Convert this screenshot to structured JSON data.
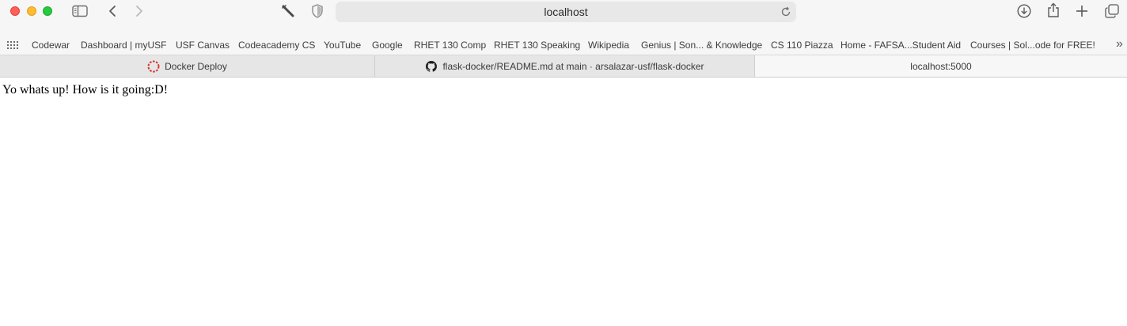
{
  "window": {
    "traffic_lights": [
      "close",
      "minimize",
      "zoom"
    ]
  },
  "toolbar": {
    "icons": [
      "sidebar-icon",
      "back-icon",
      "forward-icon",
      "extension-icon",
      "privacy-shield-icon",
      "download-icon",
      "share-icon",
      "new-tab-icon",
      "tab-overview-icon"
    ],
    "address": "localhost"
  },
  "bookmarks": {
    "items": [
      {
        "label": "Codewar"
      },
      {
        "label": "Dashboard | myUSF"
      },
      {
        "label": "USF Canvas"
      },
      {
        "label": "Codeacademy CS"
      },
      {
        "label": "YouTube"
      },
      {
        "label": "Google"
      },
      {
        "label": "RHET 130 Comp"
      },
      {
        "label": "RHET 130 Speaking"
      },
      {
        "label": "Wikipedia"
      },
      {
        "label": "Genius | Son... & Knowledge"
      },
      {
        "label": "CS 110 Piazza"
      },
      {
        "label": "Home - FAFSA...Student Aid"
      },
      {
        "label": "Courses | Sol...ode for FREE!"
      }
    ],
    "overflow": "»"
  },
  "tabs": [
    {
      "label": "Docker Deploy",
      "icon": "docker-deploy-favicon"
    },
    {
      "label": "flask-docker/README.md at main · arsalazar-usf/flask-docker",
      "icon": "github-icon"
    },
    {
      "label": "localhost:5000",
      "active": true
    }
  ],
  "page": {
    "text": "Yo whats up! How is it going:D!"
  },
  "colors": {
    "close": "#ff5f57",
    "minimize": "#febc2e",
    "zoom": "#28c840",
    "chrome_bg": "#f6f6f6",
    "address_bg": "#e8e8e8"
  }
}
